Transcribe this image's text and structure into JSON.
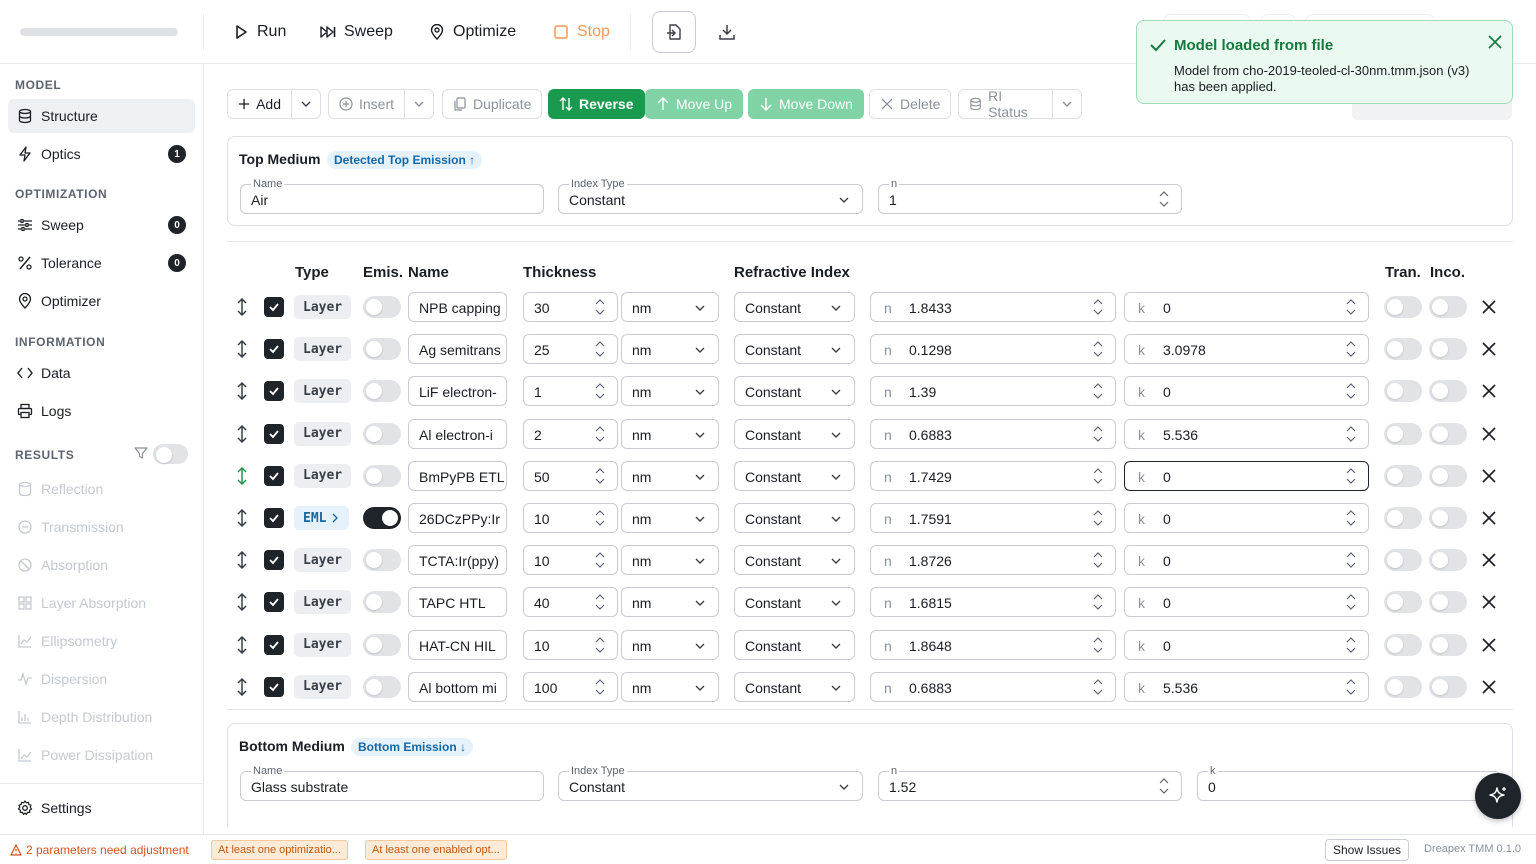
{
  "topbar": {
    "run_label": "Run",
    "sweep_label": "Sweep",
    "optimize_label": "Optimize",
    "stop_label": "Stop",
    "progress": 0
  },
  "sidebar": {
    "model_title": "MODEL",
    "model_items": [
      {
        "label": "Structure",
        "icon": "database-icon",
        "badge": ""
      },
      {
        "label": "Optics",
        "icon": "bolt-icon",
        "badge": "1"
      }
    ],
    "optimization_title": "OPTIMIZATION",
    "optimization_items": [
      {
        "label": "Sweep",
        "icon": "sliders-icon",
        "badge": "0"
      },
      {
        "label": "Tolerance",
        "icon": "percent-icon",
        "badge": "0"
      },
      {
        "label": "Optimizer",
        "icon": "target-icon",
        "badge": ""
      }
    ],
    "information_title": "INFORMATION",
    "information_items": [
      {
        "label": "Data",
        "icon": "code-icon"
      },
      {
        "label": "Logs",
        "icon": "printer-icon"
      }
    ],
    "results_title": "RESULTS",
    "results_items": [
      {
        "label": "Reflection"
      },
      {
        "label": "Transmission"
      },
      {
        "label": "Absorption"
      },
      {
        "label": "Layer Absorption"
      },
      {
        "label": "Ellipsometry"
      },
      {
        "label": "Dispersion"
      },
      {
        "label": "Depth Distribution"
      },
      {
        "label": "Power Dissipation"
      }
    ],
    "settings_label": "Settings"
  },
  "toolbar": {
    "add": "Add",
    "insert": "Insert",
    "duplicate": "Duplicate",
    "reverse": "Reverse",
    "move_up": "Move Up",
    "move_down": "Move Down",
    "delete": "Delete",
    "ri_status": "RI Status"
  },
  "top_medium": {
    "title": "Top Medium",
    "chip": "Detected Top Emission ↑",
    "name_label": "Name",
    "name_value": "Air",
    "index_type_label": "Index Type",
    "index_type_value": "Constant",
    "n_label": "n",
    "n_value": "1"
  },
  "table": {
    "headers": {
      "type": "Type",
      "emis": "Emis.",
      "name": "Name",
      "thickness": "Thickness",
      "ri": "Refractive Index",
      "tran": "Tran.",
      "inco": "Inco."
    },
    "rows": [
      {
        "type": "Layer",
        "emis": false,
        "name": "NPB capping",
        "thickness": "30",
        "unit": "nm",
        "ri_type": "Constant",
        "n": "1.8433",
        "k": "0"
      },
      {
        "type": "Layer",
        "emis": false,
        "name": "Ag semitrans",
        "thickness": "25",
        "unit": "nm",
        "ri_type": "Constant",
        "n": "0.1298",
        "k": "3.0978"
      },
      {
        "type": "Layer",
        "emis": false,
        "name": "LiF electron-",
        "thickness": "1",
        "unit": "nm",
        "ri_type": "Constant",
        "n": "1.39",
        "k": "0"
      },
      {
        "type": "Layer",
        "emis": false,
        "name": "Al electron-i",
        "thickness": "2",
        "unit": "nm",
        "ri_type": "Constant",
        "n": "0.6883",
        "k": "5.536"
      },
      {
        "type": "Layer",
        "emis": false,
        "name": "BmPyPB ETL",
        "thickness": "50",
        "unit": "nm",
        "ri_type": "Constant",
        "n": "1.7429",
        "k": "0"
      },
      {
        "type": "EML",
        "emis": true,
        "name": "26DCzPPy:Ir",
        "thickness": "10",
        "unit": "nm",
        "ri_type": "Constant",
        "n": "1.7591",
        "k": "0"
      },
      {
        "type": "Layer",
        "emis": false,
        "name": "TCTA:Ir(ppy)",
        "thickness": "10",
        "unit": "nm",
        "ri_type": "Constant",
        "n": "1.8726",
        "k": "0"
      },
      {
        "type": "Layer",
        "emis": false,
        "name": "TAPC HTL",
        "thickness": "40",
        "unit": "nm",
        "ri_type": "Constant",
        "n": "1.6815",
        "k": "0"
      },
      {
        "type": "Layer",
        "emis": false,
        "name": "HAT-CN HIL",
        "thickness": "10",
        "unit": "nm",
        "ri_type": "Constant",
        "n": "1.8648",
        "k": "0"
      },
      {
        "type": "Layer",
        "emis": false,
        "name": "Al bottom mi",
        "thickness": "100",
        "unit": "nm",
        "ri_type": "Constant",
        "n": "0.6883",
        "k": "5.536"
      }
    ]
  },
  "bottom_medium": {
    "title": "Bottom Medium",
    "chip": "Bottom Emission ↓",
    "name_label": "Name",
    "name_value": "Glass substrate",
    "index_type_label": "Index Type",
    "index_type_value": "Constant",
    "n_label": "n",
    "n_value": "1.52",
    "k_label": "k",
    "k_value": "0"
  },
  "toast": {
    "title": "Model loaded from file",
    "message": "Model from cho-2019-teoled-cl-30nm.tmm.json (v3) has been applied."
  },
  "statusbar": {
    "warning": "2 parameters need adjustment",
    "chip1": "At least one optimizatio...",
    "chip2": "At least one enabled opt...",
    "show_issues": "Show Issues",
    "version": "Dreapex TMM 0.1.0"
  },
  "colors": {
    "accent_dark": "#1f232a",
    "green": "#1a9a4f",
    "light_green": "#7fd3a5",
    "stop_orange": "#f29a5a",
    "chip_blue": "#1468a8",
    "warn_orange": "#d9531e"
  }
}
